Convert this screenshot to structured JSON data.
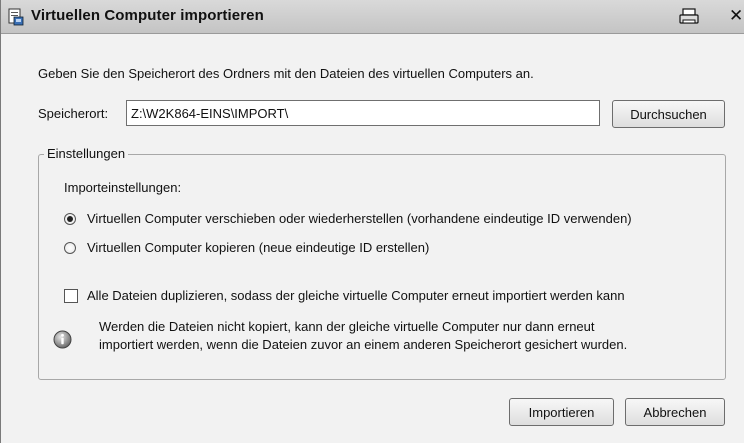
{
  "window": {
    "title": "Virtuellen Computer importieren",
    "close_glyph": "✕"
  },
  "dialog": {
    "instruction": "Geben Sie den Speicherort des Ordners mit den Dateien des virtuellen Computers an.",
    "location_label": "Speicherort:",
    "location_value": "Z:\\W2K864-EINS\\IMPORT\\",
    "browse_label": "Durchsuchen"
  },
  "settings": {
    "group_title": "Einstellungen",
    "import_settings_label": "Importeinstellungen:",
    "radio_move": {
      "label": "Virtuellen Computer verschieben oder wiederherstellen (vorhandene eindeutige ID verwenden)",
      "checked": true
    },
    "radio_copy": {
      "label": "Virtuellen Computer kopieren (neue eindeutige ID erstellen)",
      "checked": false
    },
    "duplicate_files": {
      "label": "Alle Dateien duplizieren, sodass der gleiche virtuelle Computer erneut importiert werden kann",
      "checked": false
    },
    "info_line1": "Werden die Dateien nicht kopiert, kann der gleiche virtuelle Computer nur dann erneut",
    "info_line2": "importiert werden, wenn die Dateien zuvor an einem anderen Speicherort gesichert wurden."
  },
  "footer": {
    "import_label": "Importieren",
    "cancel_label": "Abbrechen"
  },
  "icons": {
    "app": "virtual-machine-import-icon",
    "print": "printer-icon",
    "close": "close-icon",
    "info": "info-icon"
  }
}
